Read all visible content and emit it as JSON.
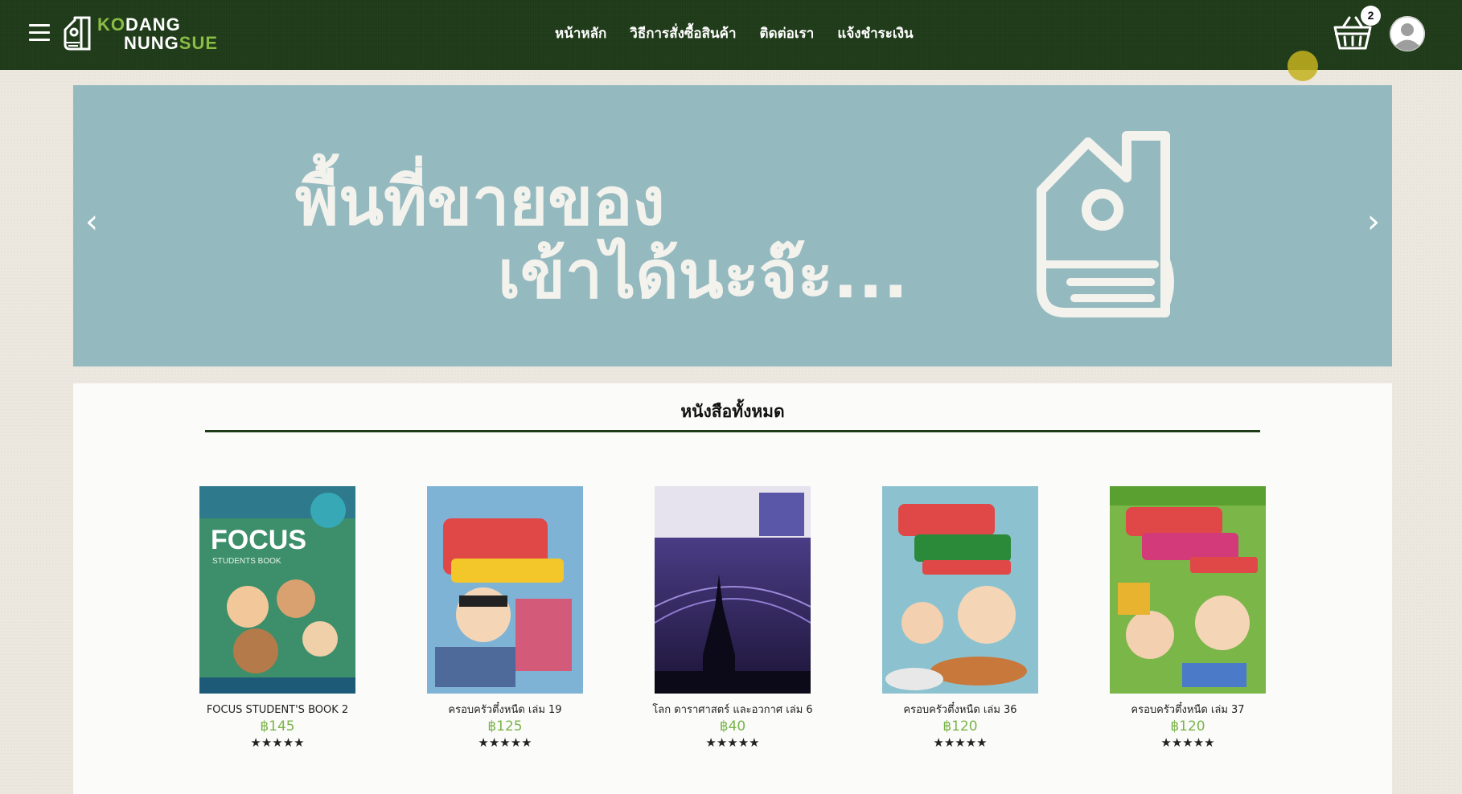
{
  "header": {
    "logo": {
      "line1_a": "KO",
      "line1_b": "DANG",
      "line2_a": "NUNG",
      "line2_b": "SUE"
    },
    "nav": [
      "หน้าหลัก",
      "วิธีการสั่งซื้อสินค้า",
      "ติดต่อเรา",
      "แจ้งชำระเงิน"
    ],
    "cart_count": "2",
    "icons": {
      "menu": "hamburger-icon",
      "cart": "basket-icon",
      "user": "user-avatar-icon"
    }
  },
  "banner": {
    "line1": "พื้นที่ขายของ",
    "line2": "เข้าได้นะจ๊ะ...",
    "prev": "‹",
    "next": "›"
  },
  "section": {
    "title": "หนังสือทั้งหมด"
  },
  "products": [
    {
      "name": "FOCUS STUDENT'S BOOK 2",
      "price": "฿145",
      "rating": "★★★★★",
      "cover_color": "#3d8e6a"
    },
    {
      "name": "ครอบครัวตึ๋งหนืด เล่ม 19",
      "price": "฿125",
      "rating": "★★★★★",
      "cover_color": "#7fb3d6"
    },
    {
      "name": "โลก ดาราศาสตร์ และอวกาศ เล่ม 6",
      "price": "฿40",
      "rating": "★★★★★",
      "cover_color": "#3c2a6a"
    },
    {
      "name": "ครอบครัวตึ๋งหนืด เล่ม 36",
      "price": "฿120",
      "rating": "★★★★★",
      "cover_color": "#8cc2d0"
    },
    {
      "name": "ครอบครัวตึ๋งหนืด เล่ม 37",
      "price": "฿120",
      "rating": "★★★★★",
      "cover_color": "#7ab648"
    }
  ],
  "colors": {
    "header_bg": "#1e3a18",
    "accent_green": "#8bbd45",
    "price_green": "#7bb44a",
    "banner_bg": "#94bac0"
  }
}
